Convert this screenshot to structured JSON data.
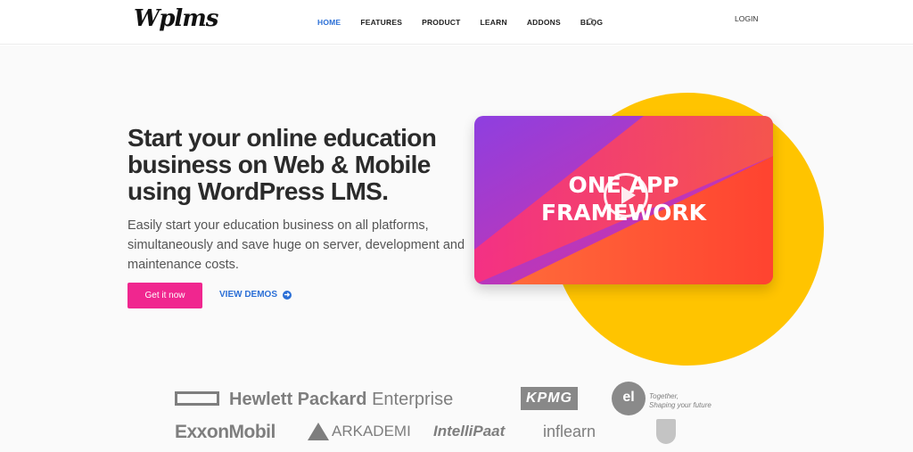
{
  "header": {
    "logo": "Wplms",
    "nav": [
      {
        "label": "HOME",
        "active": true
      },
      {
        "label": "FEATURES",
        "active": false
      },
      {
        "label": "PRODUCT",
        "active": false
      },
      {
        "label": "LEARN",
        "active": false
      },
      {
        "label": "ADDONS",
        "active": false
      },
      {
        "label": "BLOG",
        "active": false
      }
    ],
    "search_icon": "search-icon",
    "login": "LOGIN"
  },
  "hero": {
    "title": "Start your online education business on Web & Mobile using WordPress LMS.",
    "subtitle": "Easily start your education business on all platforms, simultaneously and save huge on server, development and maintenance costs.",
    "primary_cta": "Get it now",
    "secondary_cta": "VIEW DEMOS",
    "secondary_cta_icon": "arrow-right-circle-icon"
  },
  "video": {
    "line1": "ONE APP",
    "line2": "FRAMEWORK",
    "play_icon": "play-icon"
  },
  "logos": {
    "hpe_bold": "Hewlett Packard",
    "hpe_rest": " Enterprise",
    "kpmg": "KPMG",
    "el_mark": "el",
    "el_tagline_1": "Together,",
    "el_tagline_2": "Shaping your future",
    "exxon": "ExxonMobil",
    "arkademi": "ARKADEMI",
    "intellipaat": "IntelliPaat",
    "inflearn": "inflearn"
  },
  "colors": {
    "accent_blue": "#2b6fd6",
    "cta_pink": "#f0268f",
    "circle_yellow": "#ffc400"
  }
}
